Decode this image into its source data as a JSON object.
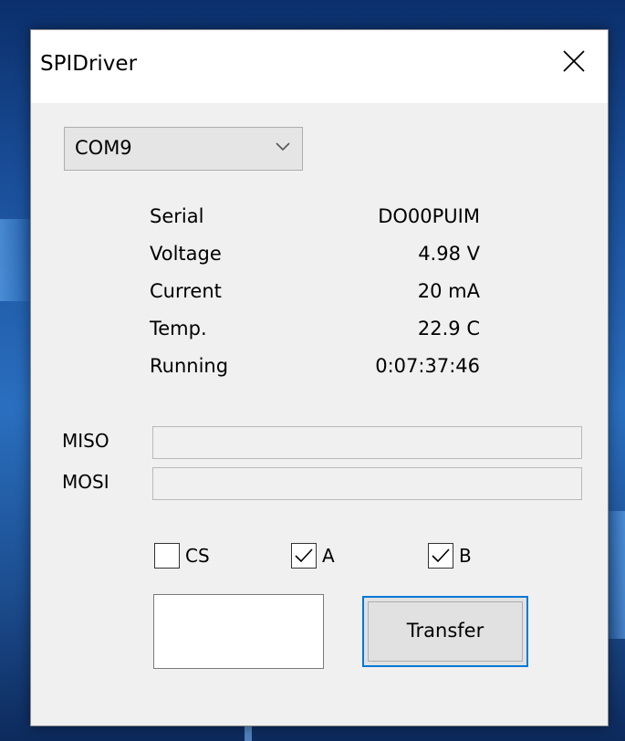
{
  "window": {
    "title": "SPIDriver"
  },
  "port": {
    "selected": "COM9"
  },
  "status": {
    "serial_label": "Serial",
    "serial_value": "DO00PUIM",
    "voltage_label": "Voltage",
    "voltage_value": "4.98 V",
    "current_label": "Current",
    "current_value": "20 mA",
    "temp_label": "Temp.",
    "temp_value": "22.9 C",
    "running_label": "Running",
    "running_value": "0:07:37:46"
  },
  "bus": {
    "miso_label": "MISO",
    "mosi_label": "MOSI",
    "miso_value": "",
    "mosi_value": ""
  },
  "controls": {
    "cs_label": "CS",
    "cs_checked": false,
    "a_label": "A",
    "a_checked": true,
    "b_label": "B",
    "b_checked": true,
    "transfer_label": "Transfer",
    "data_input": ""
  },
  "icons": {
    "close": "close-icon",
    "dropdown": "chevron-down-icon",
    "check": "checkmark-icon"
  },
  "colors": {
    "accent": "#0078d7",
    "window_bg": "#f0f0f0"
  }
}
